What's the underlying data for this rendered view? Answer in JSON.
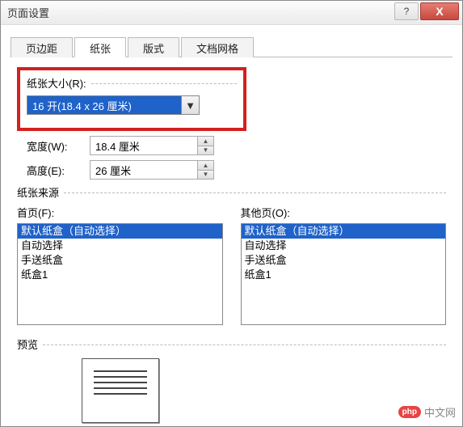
{
  "window": {
    "title": "页面设置",
    "help_glyph": "?",
    "close_glyph": "X"
  },
  "tabs": {
    "items": [
      {
        "label": "页边距"
      },
      {
        "label": "纸张"
      },
      {
        "label": "版式"
      },
      {
        "label": "文档网格"
      }
    ],
    "active_index": 1
  },
  "paper_size": {
    "group_label": "纸张大小(R):",
    "selected": "16 开(18.4 x 26 厘米)",
    "width_label": "宽度(W):",
    "width_value": "18.4 厘米",
    "height_label": "高度(E):",
    "height_value": "26 厘米"
  },
  "paper_source": {
    "group_label": "纸张来源",
    "first_page_label": "首页(F):",
    "other_page_label": "其他页(O):",
    "first_list": [
      "默认纸盒（自动选择）",
      "自动选择",
      "手送纸盒",
      "纸盒1"
    ],
    "other_list": [
      "默认纸盒（自动选择）",
      "自动选择",
      "手送纸盒",
      "纸盒1"
    ],
    "selected_index": 0
  },
  "preview": {
    "label": "预览"
  },
  "watermark": {
    "badge": "php",
    "text": "中文网"
  }
}
